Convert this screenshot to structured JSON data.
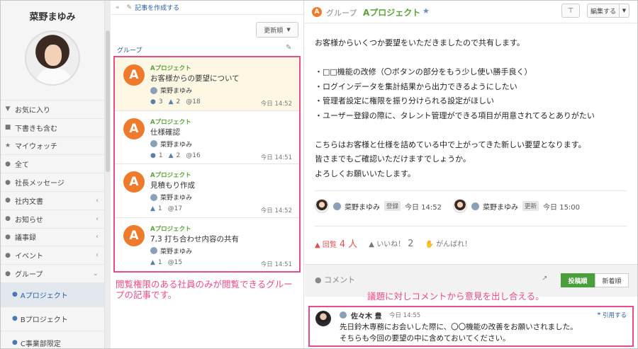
{
  "sidebar": {
    "user_name": "菜野まゆみ",
    "items": [
      {
        "label": "お気に入り",
        "icon": "pin-icon"
      },
      {
        "label": "下書きも含む",
        "icon": "lock-icon"
      },
      {
        "label": "マイウォッチ",
        "icon": "star-icon"
      },
      {
        "label": "全て",
        "icon": "group-icon"
      },
      {
        "label": "社長メッセージ",
        "icon": "group-icon"
      },
      {
        "label": "社内文書",
        "icon": "group-icon"
      },
      {
        "label": "お知らせ",
        "icon": "group-icon"
      },
      {
        "label": "議事録",
        "icon": "group-icon"
      },
      {
        "label": "イベント",
        "icon": "group-icon"
      },
      {
        "label": "グループ",
        "icon": "group-icon"
      }
    ],
    "sub_items": [
      {
        "label": "Aプロジェクト"
      },
      {
        "label": "Bプロジェクト"
      },
      {
        "label": "C事業部限定"
      }
    ]
  },
  "middle": {
    "create_label": "記事を作成する",
    "sort_label": "更新順",
    "group_label": "グループ",
    "posts": [
      {
        "group": "Aプロジェクト",
        "title": "お客様からの要望について",
        "author": "菜野まゆみ",
        "comments": "3",
        "likes": "2",
        "mentions": "@18",
        "time": "今日 14:52"
      },
      {
        "group": "Aプロジェクト",
        "title": "仕様確認",
        "author": "菜野まゆみ",
        "comments": "1",
        "likes": "2",
        "mentions": "@16",
        "time": "今日 14:51"
      },
      {
        "group": "Aプロジェクト",
        "title": "見積もり作成",
        "author": "菜野まゆみ",
        "comments": "",
        "likes": "1",
        "mentions": "@17",
        "time": "今日 14:52"
      },
      {
        "group": "Aプロジェクト",
        "title": "7,3 打ち合わせ内容の共有",
        "author": "菜野まゆみ",
        "comments": "",
        "likes": "1",
        "mentions": "@15",
        "time": "今日 14:51"
      }
    ],
    "annotation": "閲覧権限のある社員のみが閲覧できるグループの記事です。"
  },
  "detail": {
    "group_prefix": "グループ",
    "group_name": "Aプロジェクト",
    "edit_label": "編集する",
    "body": [
      "お客様からいくつか要望をいただきましたので共有します。",
      "",
      "・□□機能の改修（〇ボタンの部分をもう少し使い勝手良く）",
      "・ログインデータを集計結果から出力できるようにしたい",
      "・管理者設定に権限を振り分けられる設定がほしい",
      "・ユーザー登録の際に、タレント管理ができる項目が用意されてるとありがたい",
      "",
      "こちらはお客様と仕様を詰めている中で上がってきた新しい要望となります。",
      "皆さまでもご確認いただけますでしょうか。",
      "よろしくお願いいたします。"
    ],
    "readers": [
      {
        "name": "菜野まゆみ",
        "badge": "登録",
        "time": "今日 14:52"
      },
      {
        "name": "菜野まゆみ",
        "badge": "更新",
        "time": "今日 15:00"
      }
    ],
    "reactions": {
      "read_label": "回覧",
      "read_count": "4 人",
      "like_label": "いいね！",
      "like_count": "2",
      "cheer_label": "がんばれ！"
    },
    "comment_label": "コメント",
    "sort_posted": "投稿順",
    "sort_new": "新着順",
    "annotation": "議題に対しコメントから意見を出し合える。",
    "comment": {
      "author": "佐々木 豊",
      "time": "今日 14:55",
      "quote_label": "引用する",
      "lines": [
        "先日鈴木専務にお会いした際に、〇〇機能の改善をお願いされました。",
        "そちらも今回の要望の中に含めておいてください。"
      ]
    }
  },
  "colors": {
    "accent_pink": "#e94b8a",
    "brand_green": "#5aa13a",
    "logo_orange": "#ee7a2b",
    "link_blue": "#2a5d9f"
  }
}
